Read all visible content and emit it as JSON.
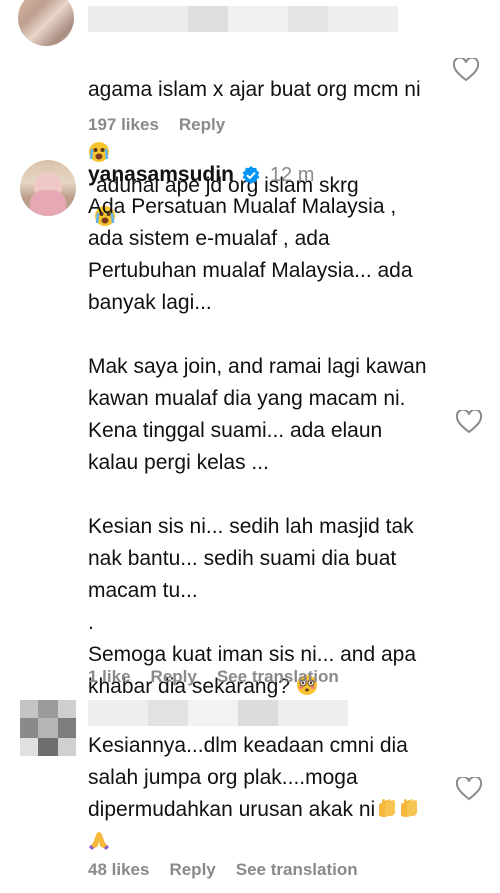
{
  "comments": [
    {
      "text_lines": [
        "agama islam x ajar buat org mcm ni",
        "aduhai ape jd org islam skrg"
      ],
      "likes": "197 likes",
      "reply": "Reply",
      "heart_icon": "heart-outline-icon"
    },
    {
      "username": "yanasamsudin",
      "time": "12 m",
      "verified_icon": "verified-badge-icon",
      "text": "Ada Persatuan Mualaf Malaysia ,\nada sistem e-mualaf , ada\nPertubuhan mualaf Malaysia... ada\nbanyak lagi...\n\nMak saya join, and ramai lagi kawan\nkawan mualaf dia yang macam ni.\nKena tinggal suami... ada elaun\nkalau pergi kelas ...\n\nKesian sis ni... sedih lah masjid tak\nnak bantu... sedih suami dia buat\nmacam tu...\n.\nSemoga kuat iman sis ni... and apa",
      "last_line": "khabar dia sekarang?",
      "likes": "1 like",
      "reply": "Reply",
      "translate": "See translation",
      "heart_icon": "heart-outline-icon"
    },
    {
      "text": "Kesiannya...dlm keadaan cmni dia\nsalah jumpa org plak....moga\ndipermudahkan urusan akak ni",
      "likes": "48 likes",
      "reply": "Reply",
      "translate": "See translation",
      "heart_icon": "heart-outline-icon"
    }
  ],
  "colors": {
    "meta": "#8a8a8a",
    "verified": "#0095f6"
  }
}
